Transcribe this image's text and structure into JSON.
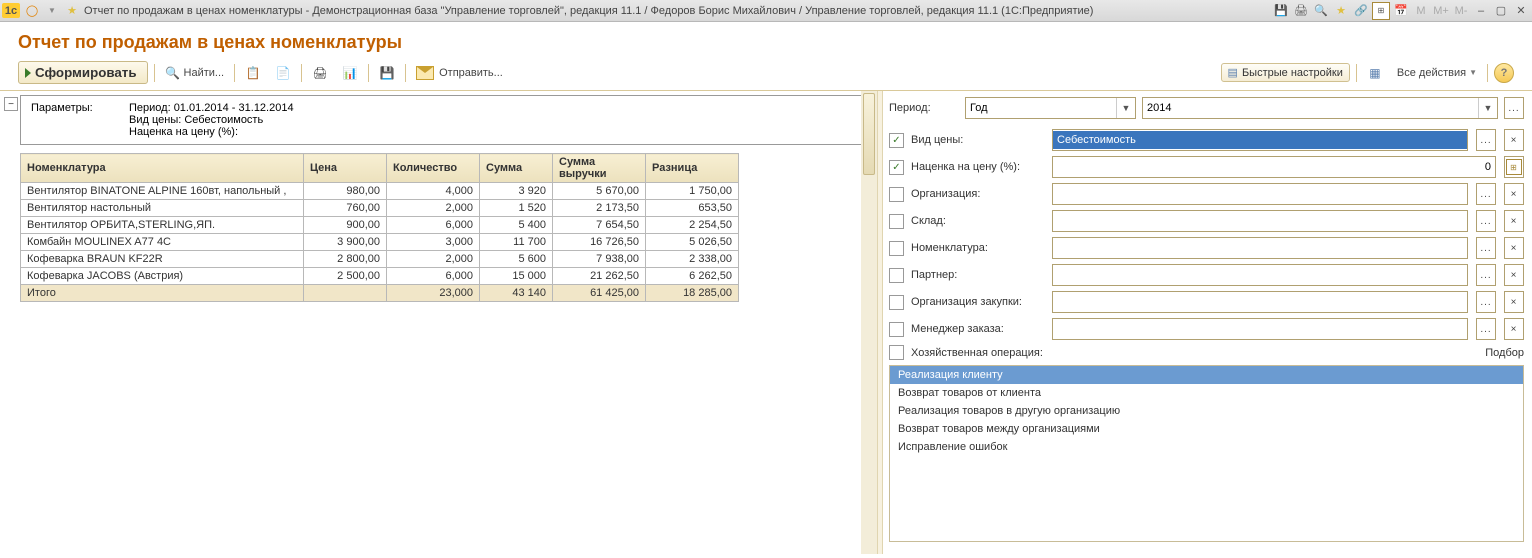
{
  "titlebar": {
    "title": "Отчет по продажам в ценах номенклатуры - Демонстрационная база \"Управление торговлей\", редакция 11.1 / Федоров Борис Михайлович / Управление торговлей, редакция 11.1  (1С:Предприятие)"
  },
  "header": {
    "title": "Отчет по продажам в ценах номенклатуры"
  },
  "toolbar": {
    "generate": "Сформировать",
    "find": "Найти...",
    "send": "Отправить...",
    "quick_settings": "Быстрые настройки",
    "all_actions": "Все действия"
  },
  "params": {
    "label": "Параметры:",
    "period_line": "Период: 01.01.2014 - 31.12.2014",
    "price_type_line": "Вид цены: Себестоимость",
    "markup_line": "Наценка на цену (%):"
  },
  "table": {
    "headers": [
      "Номенклатура",
      "Цена",
      "Количество",
      "Сумма",
      "Сумма выручки",
      "Разница"
    ],
    "rows": [
      [
        "Вентилятор BINATONE ALPINE 160вт, напольный ,",
        "980,00",
        "4,000",
        "3 920",
        "5 670,00",
        "1 750,00"
      ],
      [
        "Вентилятор настольный",
        "760,00",
        "2,000",
        "1 520",
        "2 173,50",
        "653,50"
      ],
      [
        "Вентилятор ОРБИТА,STERLING,ЯП.",
        "900,00",
        "6,000",
        "5 400",
        "7 654,50",
        "2 254,50"
      ],
      [
        "Комбайн MOULINEX  A77 4C",
        "3 900,00",
        "3,000",
        "11 700",
        "16 726,50",
        "5 026,50"
      ],
      [
        "Кофеварка BRAUN KF22R",
        "2 800,00",
        "2,000",
        "5 600",
        "7 938,00",
        "2 338,00"
      ],
      [
        "Кофеварка JACOBS (Австрия)",
        "2 500,00",
        "6,000",
        "15 000",
        "21 262,50",
        "6 262,50"
      ]
    ],
    "total_label": "Итого",
    "totals": [
      "",
      "23,000",
      "43 140",
      "61 425,00",
      "18 285,00"
    ]
  },
  "settings": {
    "period_label": "Период:",
    "period_type": "Год",
    "period_value": "2014",
    "price_type_label": "Вид цены:",
    "price_type_value": "Себестоимость",
    "markup_label": "Наценка на цену (%):",
    "markup_value": "0",
    "filters": {
      "org": "Организация:",
      "warehouse": "Склад:",
      "nomen": "Номенклатура:",
      "partner": "Партнер:",
      "purchase_org": "Организация закупки:",
      "order_mgr": "Менеджер заказа:",
      "business_op": "Хозяйственная операция:",
      "podbor": "Подбор"
    },
    "ops": [
      "Реализация клиенту",
      "Возврат товаров от клиента",
      "Реализация товаров в другую организацию",
      "Возврат товаров между организациями",
      "Исправление ошибок"
    ]
  }
}
